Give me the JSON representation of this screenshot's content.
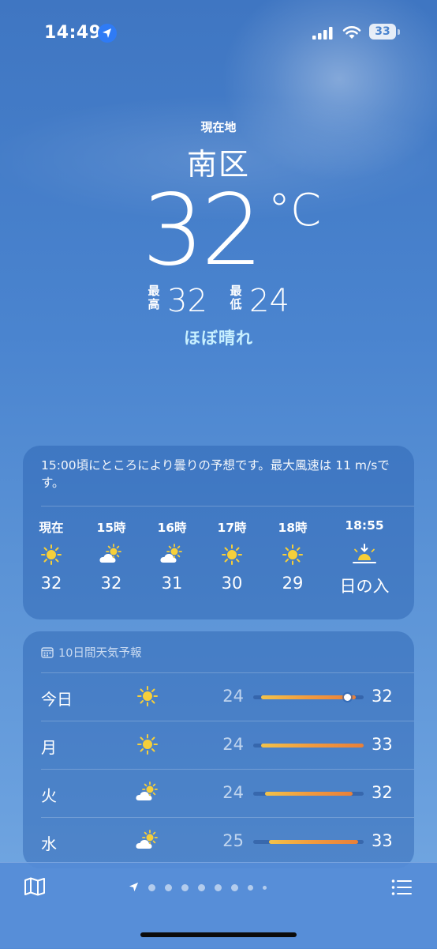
{
  "status_bar": {
    "time": "14:49",
    "battery": "33"
  },
  "hero": {
    "location_label": "現在地",
    "city": "南区",
    "temperature": "32",
    "unit": "°C",
    "high_label_1": "最",
    "high_label_2": "高",
    "high": "32",
    "low_label_1": "最",
    "low_label_2": "低",
    "low": "24",
    "condition": "ほぼ晴れ"
  },
  "hourly": {
    "summary": "15:00頃にところにより曇りの予想です。最大風速は 11 m/sです。",
    "items": [
      {
        "label": "現在",
        "icon": "sun-icon",
        "value": "32"
      },
      {
        "label": "15時",
        "icon": "partly-cloudy-icon",
        "value": "32"
      },
      {
        "label": "16時",
        "icon": "partly-cloudy-icon",
        "value": "31"
      },
      {
        "label": "17時",
        "icon": "sun-icon",
        "value": "30"
      },
      {
        "label": "18時",
        "icon": "sun-icon",
        "value": "29"
      },
      {
        "label": "18:55",
        "icon": "sunset-icon",
        "value": "日の入"
      }
    ]
  },
  "forecast": {
    "header": "10日間天気予報",
    "days": [
      {
        "day": "今日",
        "icon": "sun-icon",
        "low": "24",
        "high": "32",
        "bar_start": 0.07,
        "bar_end": 0.93,
        "current": 0.85
      },
      {
        "day": "月",
        "icon": "sun-icon",
        "low": "24",
        "high": "33",
        "bar_start": 0.07,
        "bar_end": 1.0
      },
      {
        "day": "火",
        "icon": "partly-cloudy-icon",
        "low": "24",
        "high": "32",
        "bar_start": 0.11,
        "bar_end": 0.9
      },
      {
        "day": "水",
        "icon": "partly-cloudy-icon",
        "low": "25",
        "high": "33",
        "bar_start": 0.14,
        "bar_end": 0.95
      }
    ]
  },
  "toolbar": {
    "pages": 9,
    "active_page": 0
  },
  "colors": {
    "accent_condition": "#c8f0ff",
    "location_blue": "#2f7bf5",
    "bar_warm": "#e8803a",
    "sun": "#f6cf3a"
  }
}
